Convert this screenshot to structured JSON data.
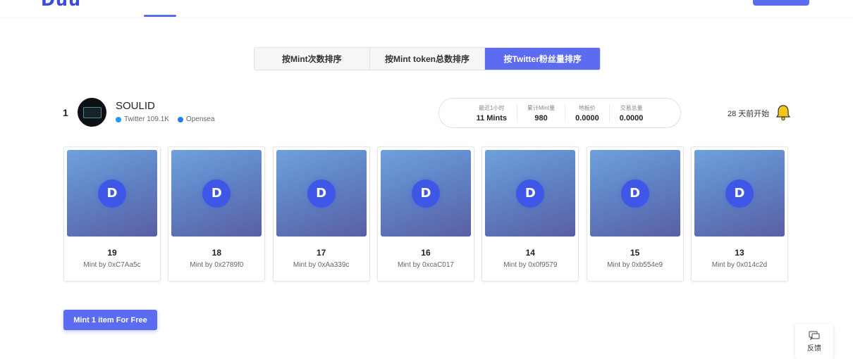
{
  "app": {
    "logo_text": "Duu"
  },
  "nav": {
    "items": [
      "",
      "",
      "",
      "",
      ""
    ],
    "accent": "#5b6cf0"
  },
  "sort_tabs": [
    {
      "label": "按Mint次数排序",
      "active": false
    },
    {
      "label": "按Mint token总数排序",
      "active": false
    },
    {
      "label": "按Twitter粉丝量排序",
      "active": true
    }
  ],
  "project": {
    "rank": "1",
    "name": "SOULID",
    "twitter_label": "Twitter 109.1K",
    "opensea_label": "Opensea",
    "stats": [
      {
        "label": "最近1小时",
        "value": "11 Mints"
      },
      {
        "label": "累计Mint量",
        "value": "980"
      },
      {
        "label": "地板价",
        "value": "0.0000"
      },
      {
        "label": "交易总量",
        "value": "0.0000"
      }
    ],
    "start_text": "28 天前开始"
  },
  "cards": [
    {
      "number": "19",
      "minted_by": "Mint by 0xC7Aa5c"
    },
    {
      "number": "18",
      "minted_by": "Mint by 0x2789f0"
    },
    {
      "number": "17",
      "minted_by": "Mint by 0xAa339c"
    },
    {
      "number": "16",
      "minted_by": "Mint by 0xcaC017"
    },
    {
      "number": "14",
      "minted_by": "Mint by 0x0f9579"
    },
    {
      "number": "15",
      "minted_by": "Mint by 0xb554e9"
    },
    {
      "number": "13",
      "minted_by": "Mint by 0x014c2d"
    }
  ],
  "card_logo_letter": "D",
  "mint_button": {
    "label": "Mint 1 item For Free"
  },
  "feedback": {
    "label": "反馈"
  }
}
